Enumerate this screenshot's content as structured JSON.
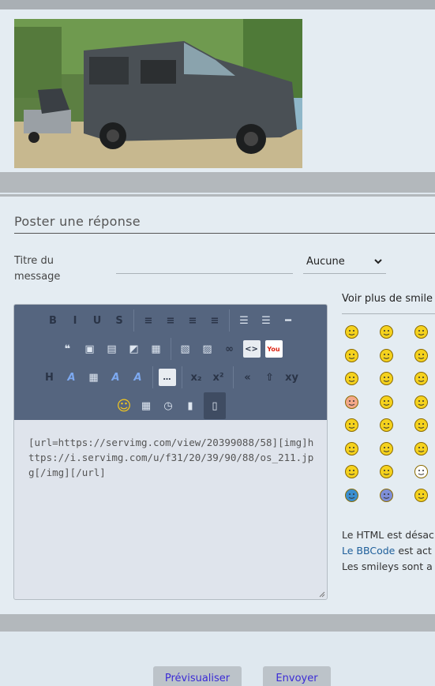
{
  "post": {
    "image_alt": "van"
  },
  "reply": {
    "title": "Poster une réponse",
    "subject_label": "Titre du message",
    "subject_value": "",
    "icon_select": {
      "selected": "Aucune"
    }
  },
  "editor": {
    "content": "[url=https://servimg.com/view/20399088/58][img]https://i.servimg.com/u/f31/20/39/90/88/os_211.jpg[/img][/url]",
    "toolbar_rows": [
      [
        {
          "name": "bold-icon",
          "glyph": "B"
        },
        {
          "name": "italic-icon",
          "glyph": "I"
        },
        {
          "name": "underline-icon",
          "glyph": "U"
        },
        {
          "name": "strike-icon",
          "glyph": "S"
        },
        {
          "sep": true
        },
        {
          "name": "align-left-icon",
          "glyph": "≡"
        },
        {
          "name": "align-center-icon",
          "glyph": "≡"
        },
        {
          "name": "align-right-icon",
          "glyph": "≡"
        },
        {
          "name": "align-justify-icon",
          "glyph": "≡"
        },
        {
          "sep": true
        },
        {
          "name": "bullet-list-icon",
          "glyph": "☰"
        },
        {
          "name": "numbered-list-icon",
          "glyph": "☰"
        },
        {
          "name": "horizontal-rule-icon",
          "glyph": "━"
        }
      ],
      [
        {
          "name": "quote-icon",
          "glyph": "❝"
        },
        {
          "name": "spoiler-icon",
          "glyph": "▣"
        },
        {
          "name": "hide-icon",
          "glyph": "▤"
        },
        {
          "name": "edit-box-icon",
          "glyph": "◩"
        },
        {
          "name": "table-icon",
          "glyph": "▦"
        },
        {
          "sep": true
        },
        {
          "name": "image-icon",
          "glyph": "▧"
        },
        {
          "name": "image-upload-icon",
          "glyph": "▨"
        },
        {
          "name": "link-icon",
          "glyph": "∞"
        },
        {
          "name": "code-icon",
          "glyph": "<>"
        },
        {
          "name": "youtube-icon",
          "glyph": "You"
        }
      ],
      [
        {
          "name": "heading-icon",
          "glyph": "H"
        },
        {
          "name": "font-icon",
          "glyph": "A"
        },
        {
          "name": "color-icon",
          "glyph": "▦"
        },
        {
          "name": "font-size-icon",
          "glyph": "A"
        },
        {
          "name": "font-face-icon",
          "glyph": "A"
        },
        {
          "sep": true
        },
        {
          "name": "more-icon",
          "glyph": "…"
        },
        {
          "sep": true
        },
        {
          "name": "subscript-icon",
          "glyph": "x₂"
        },
        {
          "name": "superscript-icon",
          "glyph": "x²"
        },
        {
          "sep": true
        },
        {
          "name": "undo-icon",
          "glyph": "«"
        },
        {
          "name": "redo-icon",
          "glyph": "⇧"
        },
        {
          "name": "replace-icon",
          "glyph": "xy"
        }
      ],
      [
        {
          "name": "smiley-picker-icon",
          "glyph": "☺"
        },
        {
          "name": "date-icon",
          "glyph": "▦"
        },
        {
          "name": "time-icon",
          "glyph": "◷"
        },
        {
          "name": "paste-icon",
          "glyph": "▮"
        },
        {
          "name": "source-mode-icon",
          "glyph": "▯",
          "active": true
        }
      ]
    ]
  },
  "smilies": {
    "heading": "Voir plus de smile",
    "items": [
      {
        "name": "happy-smiley-icon",
        "color": "#f5d21e"
      },
      {
        "name": "laughing-smiley-icon",
        "color": "#f5d21e"
      },
      {
        "name": "puzzled-smiley-icon",
        "color": "#f5d21e"
      },
      {
        "name": "smile-smiley-icon",
        "color": "#f5d21e"
      },
      {
        "name": "rolleyes-smiley-icon",
        "color": "#f5d21e"
      },
      {
        "name": "cool-smiley-icon",
        "color": "#f5d21e"
      },
      {
        "name": "grin-smiley-icon",
        "color": "#f5d21e"
      },
      {
        "name": "wink-smiley-icon",
        "color": "#f5d21e"
      },
      {
        "name": "tongue-smiley-icon",
        "color": "#f5d21e"
      },
      {
        "name": "blush-smiley-icon",
        "color": "#f3a88a"
      },
      {
        "name": "sad-smiley-icon",
        "color": "#f5d21e"
      },
      {
        "name": "evil-smiley-icon",
        "color": "#f5d21e"
      },
      {
        "name": "devil-smiley-icon",
        "color": "#f5d21e"
      },
      {
        "name": "neutral-smiley-icon",
        "color": "#f5d21e"
      },
      {
        "name": "content-smiley-icon",
        "color": "#f5d21e"
      },
      {
        "name": "exclaim-smiley-icon",
        "color": "#f5d21e"
      },
      {
        "name": "question-smiley-icon",
        "color": "#f5d21e"
      },
      {
        "name": "idea-smiley-icon",
        "color": "#f5d21e"
      },
      {
        "name": "pacman-smiley-icon",
        "color": "#f5d21e"
      },
      {
        "name": "confused-smiley-icon",
        "color": "#f5d21e"
      },
      {
        "name": "skull-smiley-icon",
        "color": "#ffffff"
      },
      {
        "name": "star-smiley-icon",
        "color": "#3a8fd0"
      },
      {
        "name": "alien-smiley-icon",
        "color": "#7f8fd8"
      },
      {
        "name": "love-smiley-icon",
        "color": "#f5d21e"
      }
    ]
  },
  "infos": {
    "html_line": "Le HTML est désac",
    "bbcode_link": "Le BBCode",
    "bbcode_rest": " est act",
    "smileys_line": "Les smileys sont a"
  },
  "buttons": {
    "preview": "Prévisualiser",
    "send": "Envoyer"
  }
}
